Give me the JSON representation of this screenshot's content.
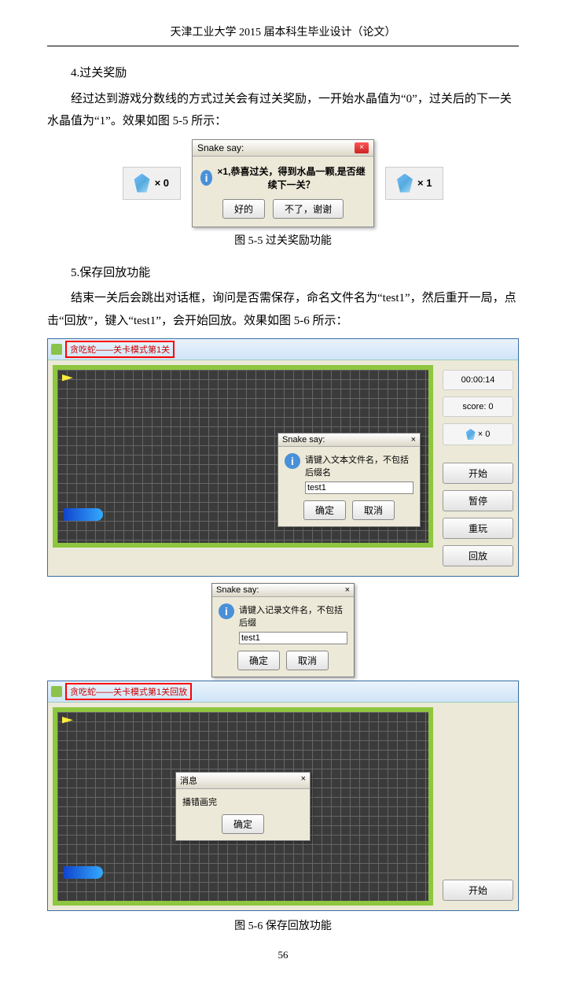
{
  "header": "天津工业大学 2015 届本科生毕业设计（论文）",
  "sec4_title": "4.过关奖励",
  "sec4_p1": "经过达到游戏分数线的方式过关会有过关奖励，一开始水晶值为“0”，过关后的下一关水晶值为“1”。效果如图 5-5 所示：",
  "fig55": {
    "crystal_left": "× 0",
    "crystal_right": "× 1",
    "dlg_title": "Snake say:",
    "dlg_msg": "×1,恭喜过关，得到水晶一颗,是否继续下一关？",
    "btn_ok": "好的",
    "btn_cancel": "不了，谢谢",
    "close": "×"
  },
  "fig55_caption": "图 5-5   过关奖励功能",
  "sec5_title": "5.保存回放功能",
  "sec5_p1": "结束一关后会跳出对话框，询问是否需保存，命名文件名为“test1”，然后重开一局，点击“回放”，键入“test1”，会开始回放。效果如图 5-6 所示：",
  "fig56a": {
    "title": "贪吃蛇——关卡模式第1关",
    "time": "00:00:14",
    "score_label": "score:  0",
    "crystal": "× 0",
    "btn_start": "开始",
    "btn_pause": "暂停",
    "btn_replay": "重玩",
    "btn_playback": "回放",
    "dlg_title": "Snake say:",
    "dlg_msg": "请键入文本文件名，不包括后缀名",
    "dlg_value": "test1",
    "btn_ok": "确定",
    "btn_cancel": "取消",
    "close": "×"
  },
  "fig56b": {
    "dlg_title": "Snake say:",
    "dlg_msg": "请键入记录文件名，不包括后缀",
    "dlg_value": "test1",
    "btn_ok": "确定",
    "btn_cancel": "取消",
    "close": "×"
  },
  "fig56c": {
    "title": "贪吃蛇——关卡模式第1关回放",
    "btn_start": "开始",
    "dlg_title": "消息",
    "dlg_msg": "播错画完",
    "btn_ok": "确定",
    "close": "×"
  },
  "fig56_caption": "图 5-6   保存回放功能",
  "pagenum": "56"
}
